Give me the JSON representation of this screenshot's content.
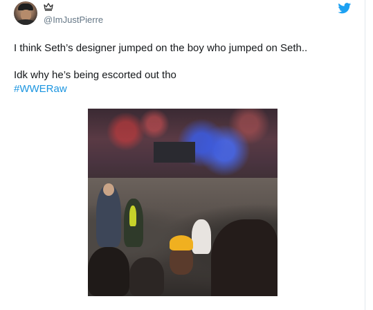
{
  "user": {
    "handle": "@ImJustPierre"
  },
  "tweet": {
    "line1": "I think Seth’s designer jumped on the boy who jumped on Seth..",
    "line2": "Idk why he’s being escorted out tho",
    "hashtag": "#WWERaw"
  },
  "icons": {
    "badge": "crown-icon",
    "brand": "twitter-bird-icon"
  },
  "colors": {
    "text": "#14171a",
    "handle": "#657786",
    "link": "#1b95e0",
    "twitter_blue": "#1da1f2"
  }
}
